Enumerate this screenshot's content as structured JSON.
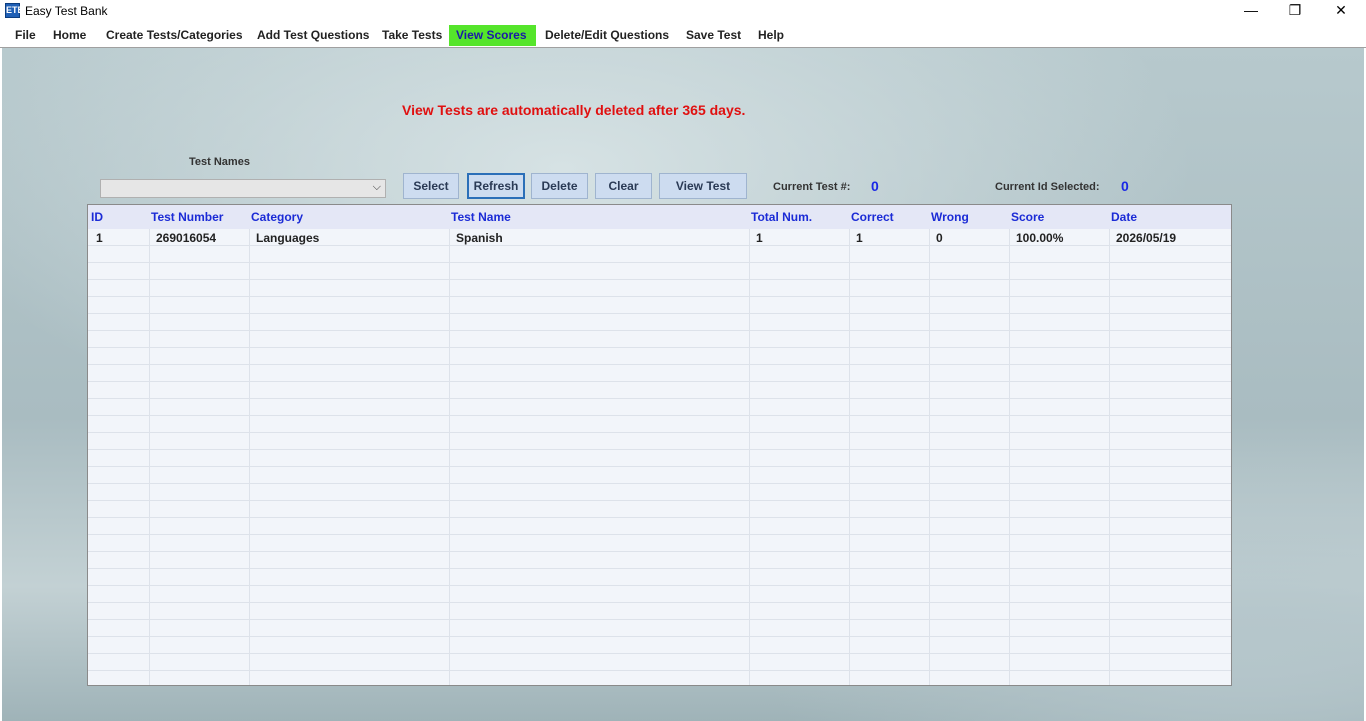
{
  "window": {
    "title": "Easy Test Bank",
    "app_icon_text": "ETB",
    "controls": {
      "minimize": "—",
      "restore": "❐",
      "close": "✕"
    }
  },
  "menu": {
    "items": [
      {
        "label": "File"
      },
      {
        "label": "Home"
      },
      {
        "label": "Create Tests/Categories"
      },
      {
        "label": "Add Test Questions"
      },
      {
        "label": "Take Tests"
      },
      {
        "label": "View Scores",
        "active": true
      },
      {
        "label": "Delete/Edit Questions"
      },
      {
        "label": "Save Test"
      },
      {
        "label": "Help"
      }
    ],
    "active_color": "#55e52b"
  },
  "notice": "View Tests are automatically deleted after 365 days.",
  "test_names": {
    "label": "Test Names",
    "value": "",
    "arrow": "⌵"
  },
  "buttons": {
    "select": "Select",
    "refresh": "Refresh",
    "delete": "Delete",
    "clear": "Clear",
    "view_test": "View Test"
  },
  "current": {
    "test_label": "Current Test #:",
    "test_value": "0",
    "id_label": "Current Id Selected:",
    "id_value": "0"
  },
  "grid": {
    "columns": [
      "ID",
      "Test Number",
      "Category",
      "Test Name",
      "Total Num.",
      "Correct",
      "Wrong",
      "Score",
      "Date"
    ],
    "rows": [
      [
        "1",
        "269016054",
        "Languages",
        "Spanish",
        "1",
        "1",
        "0",
        "100.00%",
        "2026/05/19"
      ]
    ],
    "header_color": "#1b2bd6"
  }
}
